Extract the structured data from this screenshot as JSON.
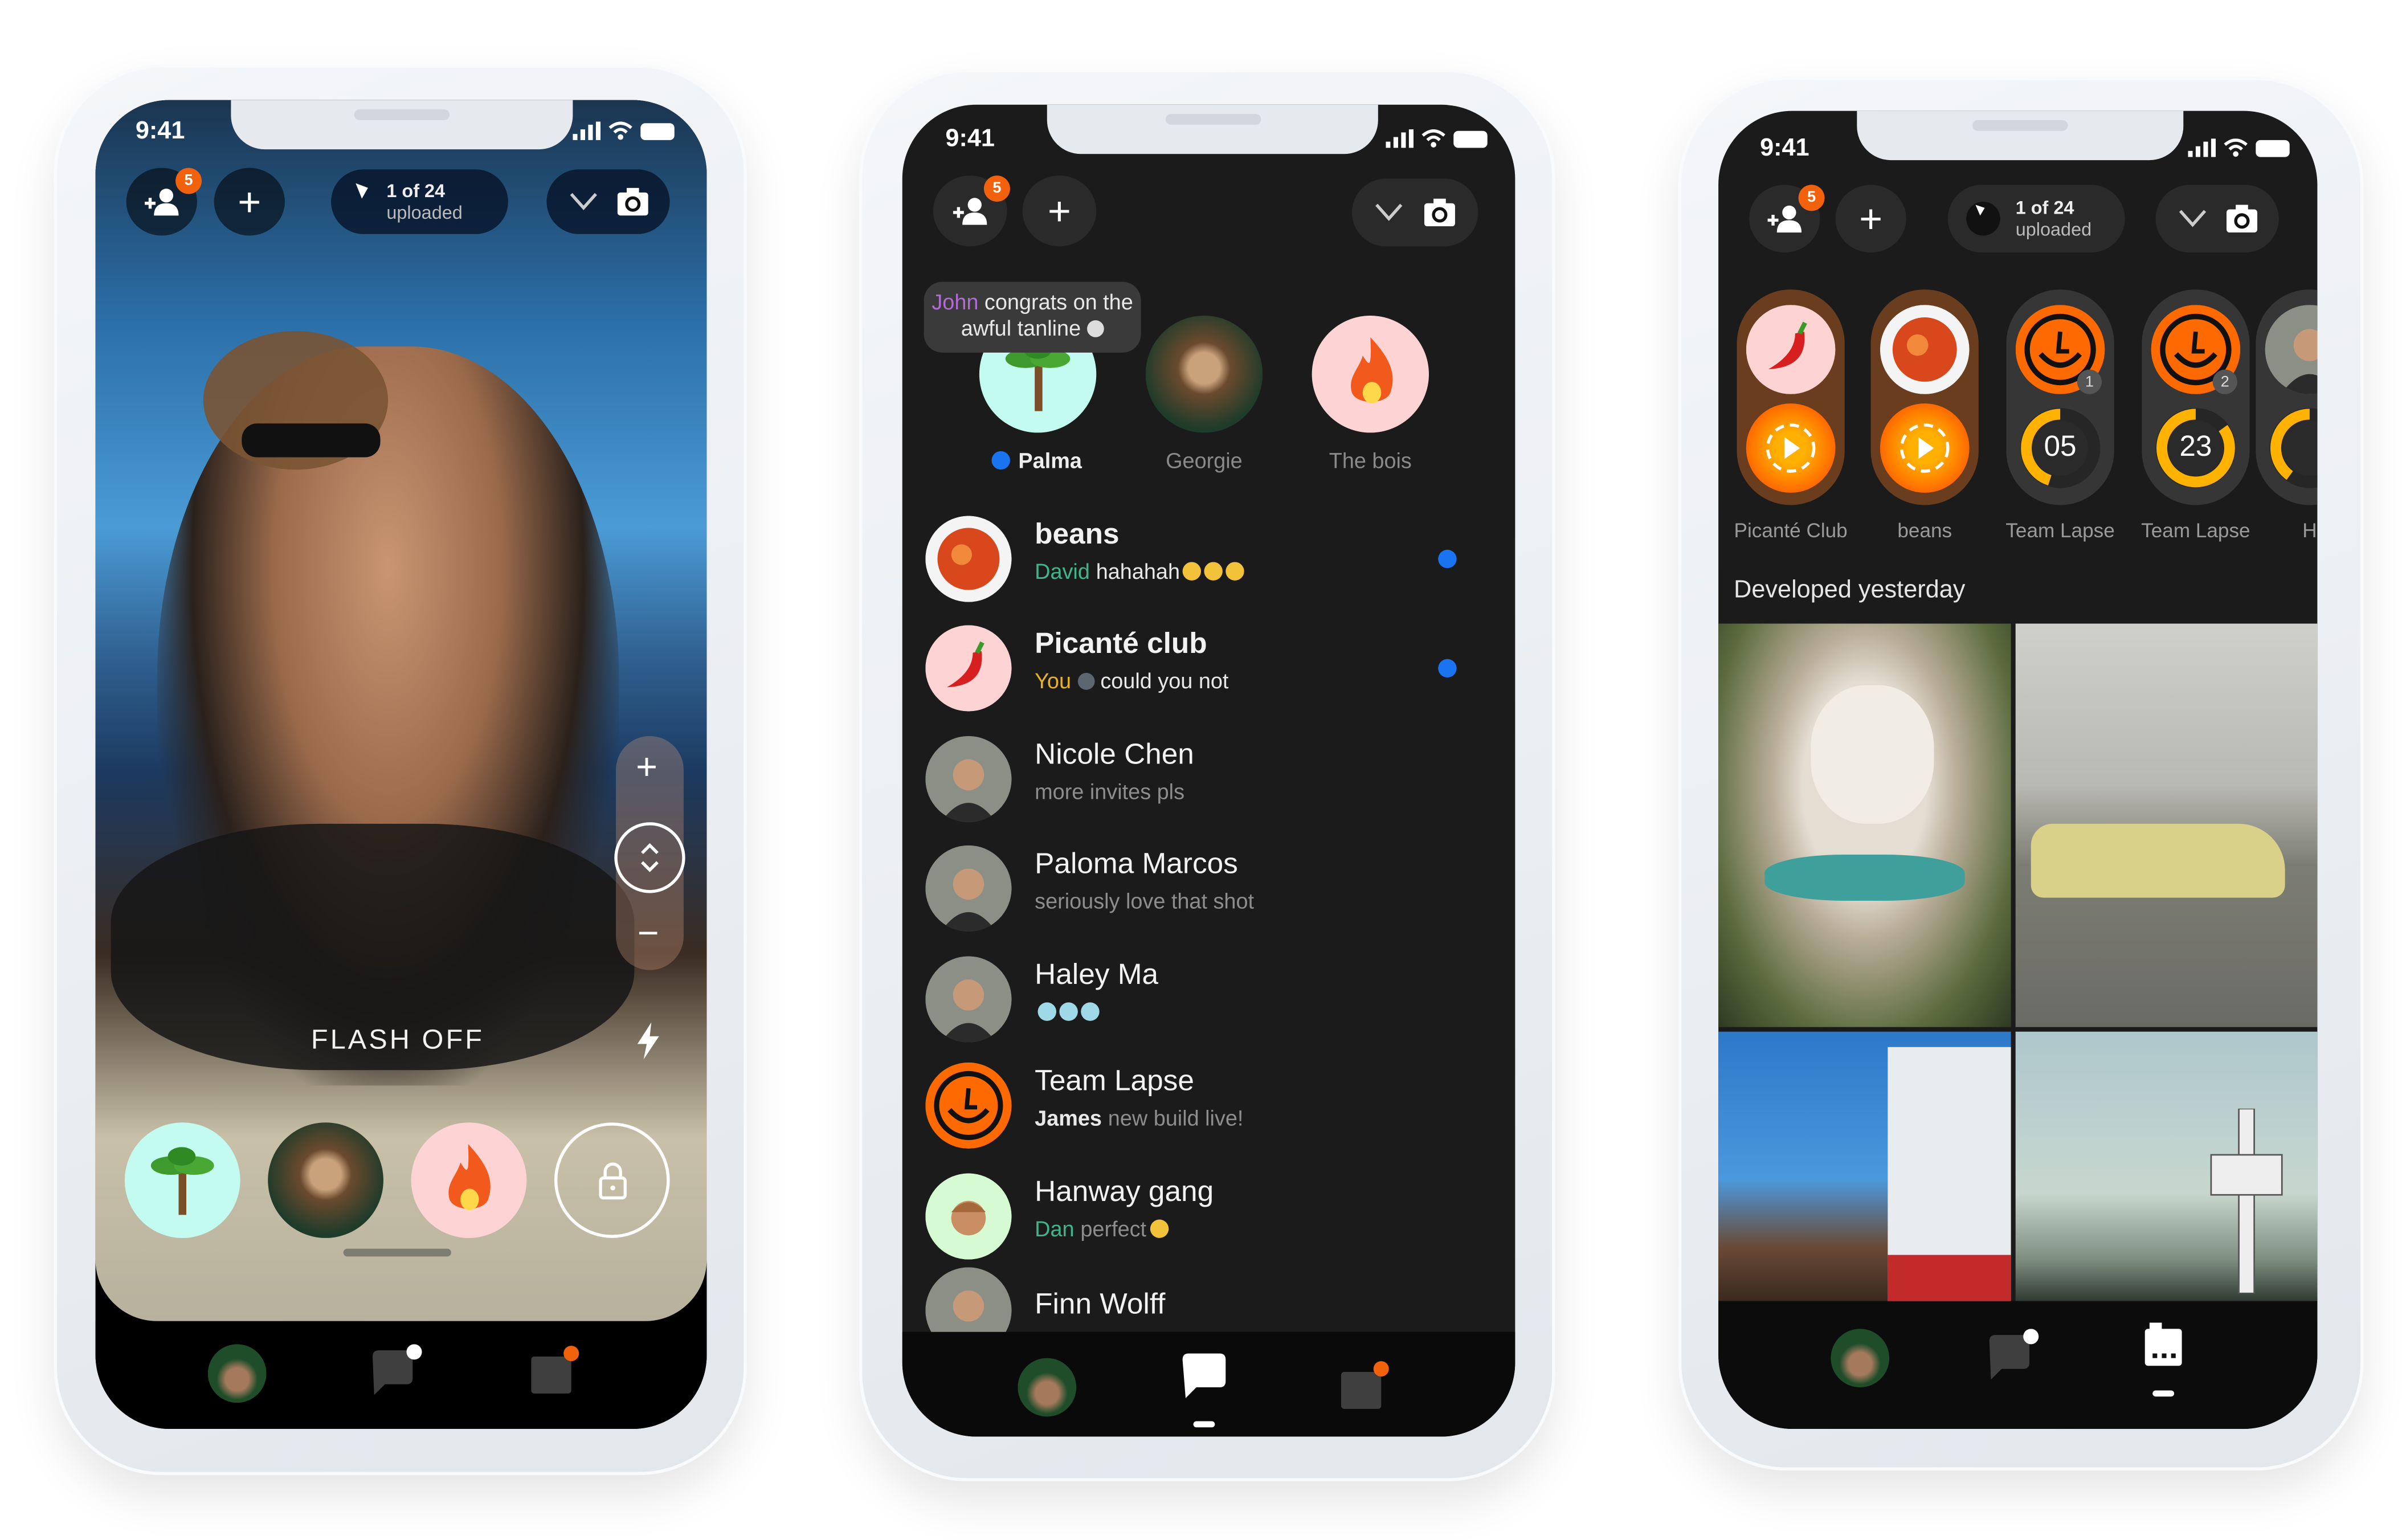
{
  "status_time": "9:41",
  "colors": {
    "accent_orange": "#f2610c",
    "unread_blue": "#1a73f0",
    "screen_bg": "#1b1b1b",
    "sender_green": "#3fb58a",
    "sender_yellow": "#e6b422",
    "sender_purple": "#b46ad6",
    "roll_brown": "#6a3d1e"
  },
  "camera": {
    "friend_badge": "5",
    "upload_count": "1 of 24",
    "upload_label": "uploaded",
    "zoom_plus": "+",
    "zoom_minus": "−",
    "flash_label": "FLASH OFF",
    "quick_send": [
      {
        "name": "palm-tree"
      },
      {
        "name": "Georgie"
      },
      {
        "name": "fire"
      }
    ]
  },
  "chats": {
    "friend_badge": "5",
    "tooltip": {
      "sender": "John",
      "text": "congrats on the awful tanline"
    },
    "stories": [
      {
        "name": "Palma",
        "unread": true
      },
      {
        "name": "Georgie",
        "unread": false
      },
      {
        "name": "The bois",
        "unread": false
      }
    ],
    "conversations": [
      {
        "name": "beans",
        "bold": true,
        "sender": "David",
        "sender_color": "#3fb58a",
        "message": "hahahah",
        "emoji": "laughing",
        "unread": true,
        "avatar": "beans"
      },
      {
        "name": "Picanté club",
        "bold": true,
        "sender": "You",
        "sender_color": "#e6b422",
        "message": "could you not",
        "emoji_before": "moon",
        "unread": true,
        "avatar": "chili"
      },
      {
        "name": "Nicole Chen",
        "bold": false,
        "sender": "",
        "message": "more invites pls",
        "unread": false,
        "avatar": "photo"
      },
      {
        "name": "Paloma Marcos",
        "bold": false,
        "sender": "",
        "message": "seriously love that shot",
        "unread": false,
        "avatar": "photo"
      },
      {
        "name": "Haley Ma",
        "bold": false,
        "sender": "",
        "message": "",
        "emoji": "diamonds",
        "unread": false,
        "avatar": "photo"
      },
      {
        "name": "Team Lapse",
        "bold": false,
        "sender": "James",
        "sender_color": "#e8e8e8",
        "message": "new build live!",
        "unread": false,
        "avatar": "lapse"
      },
      {
        "name": "Hanway gang",
        "bold": false,
        "sender": "Dan",
        "sender_color": "#3fb58a",
        "message": "perfect",
        "emoji": "ok-hand",
        "unread": false,
        "avatar": "boy"
      },
      {
        "name": "Finn Wolff",
        "bold": false,
        "sender": "",
        "message": "",
        "unread": false,
        "avatar": "photo"
      }
    ]
  },
  "albums": {
    "friend_badge": "5",
    "upload_count": "1 of 24",
    "upload_label": "uploaded",
    "rolls": [
      {
        "name": "Picanté Club",
        "kind": "developed",
        "avatar": "chili"
      },
      {
        "name": "beans",
        "kind": "developed",
        "avatar": "beans"
      },
      {
        "name": "Team Lapse",
        "kind": "developing",
        "badge": "1",
        "count": "05",
        "progress": 0.45,
        "avatar": "lapse"
      },
      {
        "name": "Team Lapse",
        "kind": "developing",
        "badge": "2",
        "count": "23",
        "progress": 0.85,
        "avatar": "lapse"
      },
      {
        "name": "H",
        "kind": "developing",
        "progress": 0.4,
        "avatar": "photo"
      }
    ],
    "section_title": "Developed yesterday",
    "photos": [
      {
        "subject": "bulldog"
      },
      {
        "subject": "yellow-car"
      },
      {
        "subject": "building"
      },
      {
        "subject": "cross-sign"
      }
    ]
  }
}
